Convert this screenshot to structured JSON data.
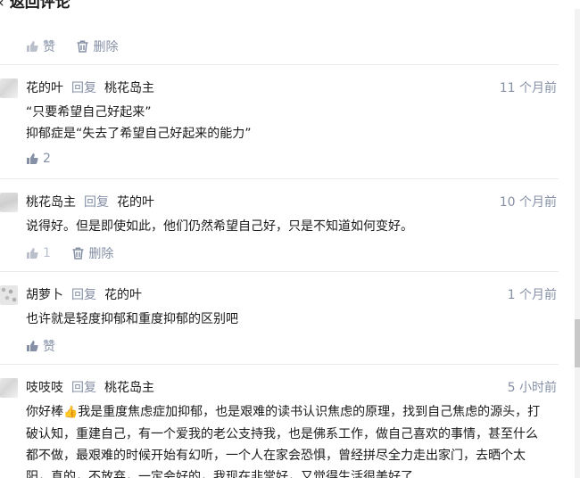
{
  "header": {
    "back_label": "返回评论"
  },
  "prev_comment": {
    "partial_text": "……",
    "like_label": "赞",
    "delete_label": "删除"
  },
  "comments": [
    {
      "author": "花的叶",
      "reply_word": "回复",
      "target": "桃花岛主",
      "time": "11 个月前",
      "lines": [
        "“只要希望自己好起来”",
        "抑郁症是“失去了希望自己好起来的能力”"
      ],
      "like_count": "2"
    },
    {
      "author": "桃花岛主",
      "reply_word": "回复",
      "target": "花的叶",
      "time": "10 个月前",
      "lines": [
        "说得好。但是即使如此，他们仍然希望自己好，只是不知道如何变好。"
      ],
      "like_count": "1",
      "delete_label": "删除"
    },
    {
      "author": "胡萝卜",
      "reply_word": "回复",
      "target": "花的叶",
      "time": "1 个月前",
      "lines": [
        "也许就是轻度抑郁和重度抑郁的区别吧"
      ],
      "like_label": "赞"
    },
    {
      "author": "吱吱吱",
      "reply_word": "回复",
      "target": "桃花岛主",
      "time": "5 小时前",
      "text_prefix": "你好棒",
      "emoji": "👍",
      "text_rest": "我是重度焦虑症加抑郁，也是艰难的读书认识焦虑的原理，找到自己焦虑的源头，打破认知，重建自己，有一个爱我的老公支持我，也是佛系工作，做自己喜欢的事情，甚至什么都不做，最艰难的时候开始有幻听，一个人在家会恐惧，曾经拼尽全力走出家门，去晒个太阳，真的，不放弃，一定会好的，我现在非常好，又觉得生活很美好了"
    }
  ]
}
